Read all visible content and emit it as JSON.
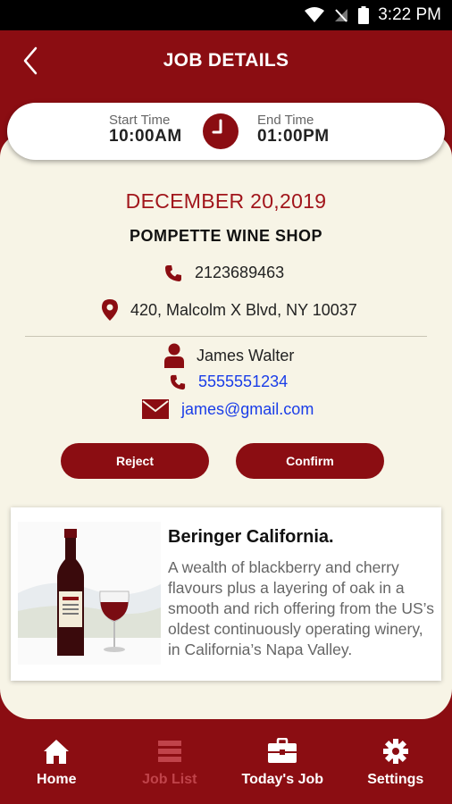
{
  "status_bar": {
    "time": "3:22 PM"
  },
  "header": {
    "title": "JOB DETAILS"
  },
  "schedule": {
    "start_label": "Start Time",
    "start_value": "10:00AM",
    "end_label": "End Time",
    "end_value": "01:00PM"
  },
  "job": {
    "date": "DECEMBER 20,2019",
    "shop_name": "POMPETTE WINE SHOP",
    "shop_phone": "2123689463",
    "address": "420, Malcolm X Blvd, NY 10037"
  },
  "contact": {
    "name": "James Walter",
    "phone": "5555551234",
    "email": "james@gmail.com"
  },
  "actions": {
    "reject_label": "Reject",
    "confirm_label": "Confirm"
  },
  "product": {
    "name": "Beringer California.",
    "description": "A wealth of blackberry and cherry flavours plus a layering of oak in a smooth and rich offering from the US’s oldest continuously operating winery, in California’s Napa Valley."
  },
  "tabs": [
    {
      "label": "Home",
      "icon": "home-icon"
    },
    {
      "label": "Job List",
      "icon": "list-icon"
    },
    {
      "label": "Today's Job",
      "icon": "briefcase-icon"
    },
    {
      "label": "Settings",
      "icon": "gear-icon"
    }
  ],
  "colors": {
    "brand": "#8b0d12",
    "background": "#f7f4e6",
    "date_text": "#a1151b",
    "link": "#1a3de8",
    "inactive_tab": "#c0434a"
  }
}
